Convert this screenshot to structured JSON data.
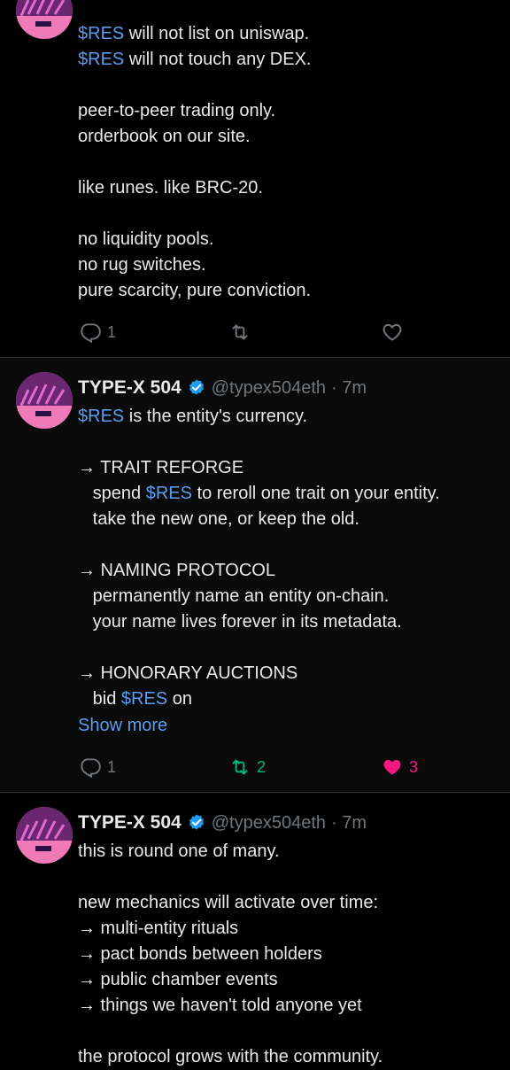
{
  "tweet1": {
    "lines": [
      {
        "cash": "$RES",
        "text": " will not list on uniswap."
      },
      {
        "cash": "$RES",
        "text": " will not touch any DEX."
      },
      {
        "cash": "",
        "text": ""
      },
      {
        "cash": "",
        "text": "peer-to-peer trading only."
      },
      {
        "cash": "",
        "text": "orderbook on our site."
      },
      {
        "cash": "",
        "text": ""
      },
      {
        "cash": "",
        "text": "like runes. like BRC-20."
      },
      {
        "cash": "",
        "text": ""
      },
      {
        "cash": "",
        "text": "no liquidity pools."
      },
      {
        "cash": "",
        "text": "no rug switches."
      },
      {
        "cash": "",
        "text": "pure scarcity, pure conviction."
      }
    ],
    "reply_count": "1",
    "retweet_count": "",
    "like_count": ""
  },
  "tweet2": {
    "author_name": "TYPE-X 504",
    "handle": "@typex504eth",
    "time": "· 7m",
    "lines": [
      {
        "pre": "",
        "cash": "$RES",
        "text": " is the entity's currency."
      },
      {
        "pre": "",
        "cash": "",
        "text": ""
      },
      {
        "pre": "→ TRAIT REFORGE",
        "cash": "",
        "text": ""
      },
      {
        "pre": "   spend ",
        "cash": "$RES",
        "text": " to reroll one trait on your entity."
      },
      {
        "pre": "   take the new one, or keep the old.",
        "cash": "",
        "text": ""
      },
      {
        "pre": "",
        "cash": "",
        "text": ""
      },
      {
        "pre": "→ NAMING PROTOCOL",
        "cash": "",
        "text": ""
      },
      {
        "pre": "   permanently name an entity on-chain.",
        "cash": "",
        "text": ""
      },
      {
        "pre": "   your name lives forever in its metadata.",
        "cash": "",
        "text": ""
      },
      {
        "pre": "",
        "cash": "",
        "text": ""
      },
      {
        "pre": "→ HONORARY AUCTIONS",
        "cash": "",
        "text": ""
      },
      {
        "pre": "   bid ",
        "cash": "$RES",
        "text": " on"
      }
    ],
    "show_more": "Show more",
    "reply_count": "1",
    "retweet_count": "2",
    "like_count": "3"
  },
  "tweet3": {
    "author_name": "TYPE-X 504",
    "handle": "@typex504eth",
    "time": "· 7m",
    "lines": [
      "this is round one of many.",
      "",
      "new mechanics will activate over time:",
      "→ multi-entity rituals",
      "→ pact bonds between holders",
      "→ public chamber events",
      "→ things we haven't told anyone yet",
      "",
      "the protocol grows with the community."
    ]
  },
  "colors": {
    "accent": "#5b9df0",
    "retweet_active": "#00ba7c",
    "like_active": "#f91880",
    "avatar_top": "#7a2f7a",
    "avatar_bottom": "#f07ab8"
  }
}
